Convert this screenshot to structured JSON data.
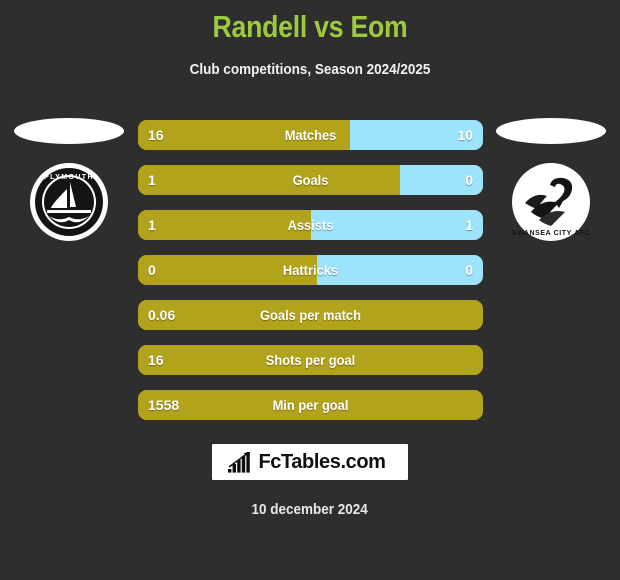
{
  "header": {
    "title": "Randell vs Eom",
    "subtitle": "Club competitions, Season 2024/2025"
  },
  "colors": {
    "background": "#2e2e2e",
    "title_green": "#9fc93c",
    "home_gold": "#b2a31c",
    "away_blue": "#9ce3fb",
    "text_white": "#ffffff",
    "brand_bg": "#ffffff"
  },
  "teams": {
    "home": {
      "crest_name": "plymouth-argyle-crest",
      "crest_text": "PLYMOUTH"
    },
    "away": {
      "crest_name": "swansea-city-crest",
      "crest_text": "SWANSEA CITY AFC"
    }
  },
  "chart_data": {
    "type": "bar",
    "title": "Randell vs Eom",
    "subtitle": "Club competitions, Season 2024/2025",
    "orientation": "horizontal-diverging",
    "series": [
      {
        "name": "Randell",
        "side": "left",
        "color": "#b2a31c"
      },
      {
        "name": "Eom",
        "side": "right",
        "color": "#9ce3fb"
      }
    ],
    "categories": [
      "Matches",
      "Goals",
      "Assists",
      "Hattricks",
      "Goals per match",
      "Shots per goal",
      "Min per goal"
    ],
    "rows": [
      {
        "label": "Matches",
        "home": "16",
        "away": "10",
        "home_pct": 61.5,
        "split": true
      },
      {
        "label": "Goals",
        "home": "1",
        "away": "0",
        "home_pct": 76.0,
        "split": true
      },
      {
        "label": "Assists",
        "home": "1",
        "away": "1",
        "home_pct": 50.0,
        "split": true
      },
      {
        "label": "Hattricks",
        "home": "0",
        "away": "0",
        "home_pct": 52.0,
        "split": true
      },
      {
        "label": "Goals per match",
        "home": "0.06",
        "away": "",
        "home_pct": 100,
        "split": false
      },
      {
        "label": "Shots per goal",
        "home": "16",
        "away": "",
        "home_pct": 100,
        "split": false
      },
      {
        "label": "Min per goal",
        "home": "1558",
        "away": "",
        "home_pct": 100,
        "split": false
      }
    ]
  },
  "footer": {
    "brand": "FcTables.com",
    "brand_icon": "bar-chart-arrow-icon",
    "date": "10 december 2024"
  }
}
